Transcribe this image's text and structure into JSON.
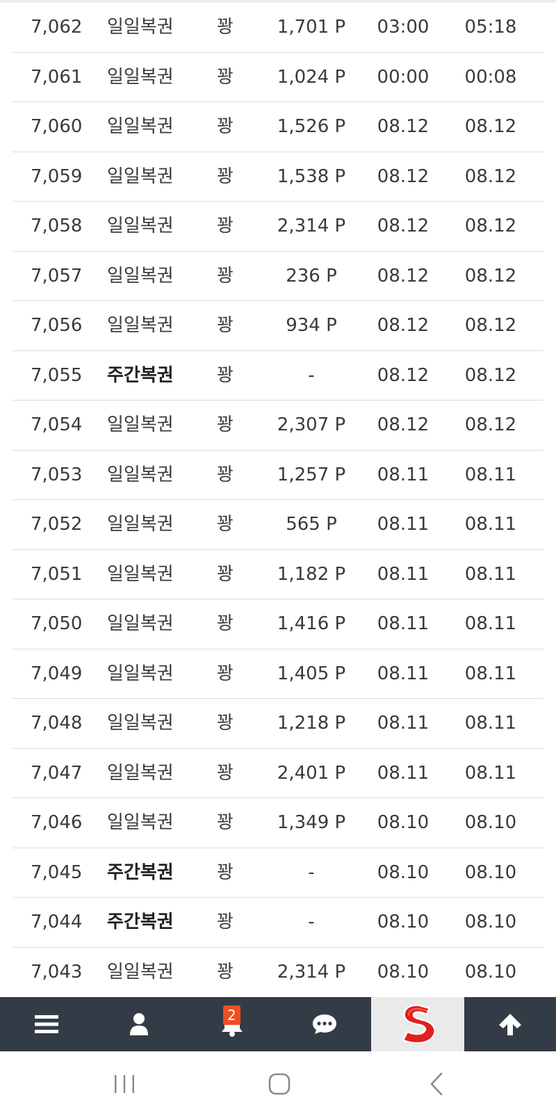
{
  "rows": [
    {
      "no": "7,062",
      "name": "일일복권",
      "bold": false,
      "result": "꽝",
      "point": "1,701 P",
      "t1": "03:00",
      "t2": "05:18"
    },
    {
      "no": "7,061",
      "name": "일일복권",
      "bold": false,
      "result": "꽝",
      "point": "1,024 P",
      "t1": "00:00",
      "t2": "00:08"
    },
    {
      "no": "7,060",
      "name": "일일복권",
      "bold": false,
      "result": "꽝",
      "point": "1,526 P",
      "t1": "08.12",
      "t2": "08.12"
    },
    {
      "no": "7,059",
      "name": "일일복권",
      "bold": false,
      "result": "꽝",
      "point": "1,538 P",
      "t1": "08.12",
      "t2": "08.12"
    },
    {
      "no": "7,058",
      "name": "일일복권",
      "bold": false,
      "result": "꽝",
      "point": "2,314 P",
      "t1": "08.12",
      "t2": "08.12"
    },
    {
      "no": "7,057",
      "name": "일일복권",
      "bold": false,
      "result": "꽝",
      "point": "236 P",
      "t1": "08.12",
      "t2": "08.12"
    },
    {
      "no": "7,056",
      "name": "일일복권",
      "bold": false,
      "result": "꽝",
      "point": "934 P",
      "t1": "08.12",
      "t2": "08.12"
    },
    {
      "no": "7,055",
      "name": "주간복권",
      "bold": true,
      "result": "꽝",
      "point": "-",
      "t1": "08.12",
      "t2": "08.12"
    },
    {
      "no": "7,054",
      "name": "일일복권",
      "bold": false,
      "result": "꽝",
      "point": "2,307 P",
      "t1": "08.12",
      "t2": "08.12"
    },
    {
      "no": "7,053",
      "name": "일일복권",
      "bold": false,
      "result": "꽝",
      "point": "1,257 P",
      "t1": "08.11",
      "t2": "08.11"
    },
    {
      "no": "7,052",
      "name": "일일복권",
      "bold": false,
      "result": "꽝",
      "point": "565 P",
      "t1": "08.11",
      "t2": "08.11"
    },
    {
      "no": "7,051",
      "name": "일일복권",
      "bold": false,
      "result": "꽝",
      "point": "1,182 P",
      "t1": "08.11",
      "t2": "08.11"
    },
    {
      "no": "7,050",
      "name": "일일복권",
      "bold": false,
      "result": "꽝",
      "point": "1,416 P",
      "t1": "08.11",
      "t2": "08.11"
    },
    {
      "no": "7,049",
      "name": "일일복권",
      "bold": false,
      "result": "꽝",
      "point": "1,405 P",
      "t1": "08.11",
      "t2": "08.11"
    },
    {
      "no": "7,048",
      "name": "일일복권",
      "bold": false,
      "result": "꽝",
      "point": "1,218 P",
      "t1": "08.11",
      "t2": "08.11"
    },
    {
      "no": "7,047",
      "name": "일일복권",
      "bold": false,
      "result": "꽝",
      "point": "2,401 P",
      "t1": "08.11",
      "t2": "08.11"
    },
    {
      "no": "7,046",
      "name": "일일복권",
      "bold": false,
      "result": "꽝",
      "point": "1,349 P",
      "t1": "08.10",
      "t2": "08.10"
    },
    {
      "no": "7,045",
      "name": "주간복권",
      "bold": true,
      "result": "꽝",
      "point": "-",
      "t1": "08.10",
      "t2": "08.10"
    },
    {
      "no": "7,044",
      "name": "주간복권",
      "bold": true,
      "result": "꽝",
      "point": "-",
      "t1": "08.10",
      "t2": "08.10"
    },
    {
      "no": "7,043",
      "name": "일일복권",
      "bold": false,
      "result": "꽝",
      "point": "2,314 P",
      "t1": "08.10",
      "t2": "08.10"
    }
  ],
  "bottom_nav": {
    "menu_icon": "hamburger-icon",
    "user_icon": "user-icon",
    "bell_icon": "bell-icon",
    "notification_count": "2",
    "chat_icon": "chat-bubble-icon",
    "logo_icon": "s-logo-icon",
    "top_icon": "arrow-up-icon",
    "background": "#333c46",
    "badge_color": "#f04e23",
    "logo_color": "#e0201d"
  },
  "system_nav": {
    "recent_icon": "recent-apps-icon",
    "home_icon": "home-icon",
    "back_icon": "back-icon"
  }
}
